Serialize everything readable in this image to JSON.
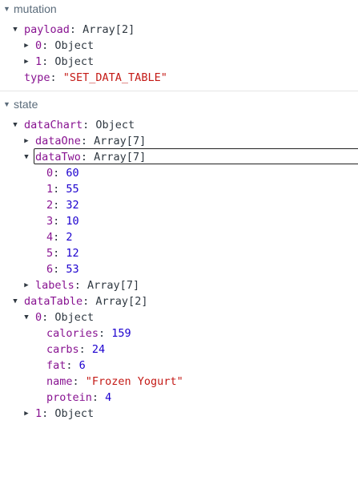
{
  "mutation": {
    "header": "mutation",
    "payload": {
      "key": "payload",
      "value": "Array[2]"
    },
    "payload_items": [
      {
        "key": "0",
        "value": "Object"
      },
      {
        "key": "1",
        "value": "Object"
      }
    ],
    "type": {
      "key": "type",
      "value": "\"SET_DATA_TABLE\""
    }
  },
  "state": {
    "header": "state",
    "dataChart": {
      "key": "dataChart",
      "value": "Object"
    },
    "dataOne": {
      "key": "dataOne",
      "value": "Array[7]"
    },
    "dataTwo": {
      "key": "dataTwo",
      "value": "Array[7]"
    },
    "dataTwo_items": [
      {
        "key": "0",
        "value": "60"
      },
      {
        "key": "1",
        "value": "55"
      },
      {
        "key": "2",
        "value": "32"
      },
      {
        "key": "3",
        "value": "10"
      },
      {
        "key": "4",
        "value": "2"
      },
      {
        "key": "5",
        "value": "12"
      },
      {
        "key": "6",
        "value": "53"
      }
    ],
    "labels": {
      "key": "labels",
      "value": "Array[7]"
    },
    "dataTable": {
      "key": "dataTable",
      "value": "Array[2]"
    },
    "item0": {
      "key": "0",
      "value": "Object"
    },
    "item0_fields": {
      "calories": {
        "key": "calories",
        "value": "159"
      },
      "carbs": {
        "key": "carbs",
        "value": "24"
      },
      "fat": {
        "key": "fat",
        "value": "6"
      },
      "name": {
        "key": "name",
        "value": "\"Frozen Yogurt\""
      },
      "protein": {
        "key": "protein",
        "value": "4"
      }
    },
    "item1": {
      "key": "1",
      "value": "Object"
    }
  },
  "colors": {
    "key": "#881391",
    "number": "#1c00cf",
    "string": "#c41a16",
    "header": "#5a6b7a"
  },
  "icons": {
    "expanded": "triangle-down-icon",
    "collapsed": "triangle-right-icon"
  }
}
